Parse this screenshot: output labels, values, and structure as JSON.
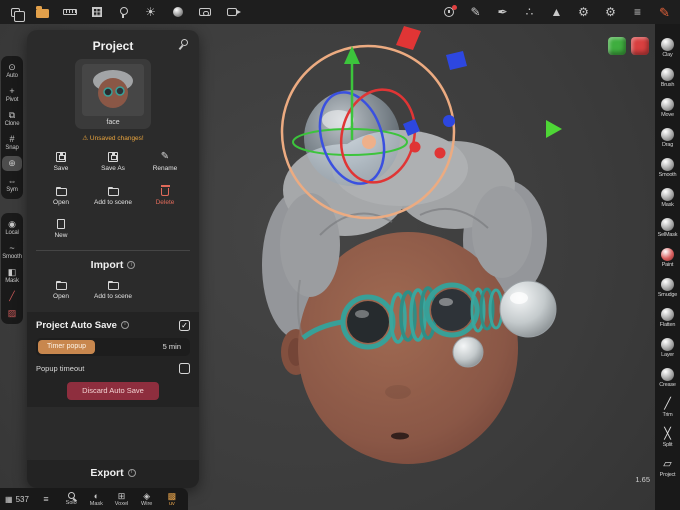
{
  "topbar": {
    "left_icons": [
      "scene-pages-icon",
      "files-folder-icon",
      "measure-icon",
      "topology-grid-icon",
      "lighting-icon",
      "environment-sun-icon",
      "material-sphere-icon",
      "camera-icon",
      "render-video-icon"
    ],
    "right_icons": [
      "record-timer-icon",
      "pencil-icon",
      "pen-icon",
      "airbrush-icon",
      "smudge-icon",
      "settings-gear-icon",
      "interface-gear-icon",
      "menu-icon",
      "stylus-pressure-icon"
    ]
  },
  "left_toolbar": {
    "group1": [
      {
        "label": "Auto",
        "icon": "auto-icon"
      },
      {
        "label": "Pivot",
        "icon": "pivot-icon"
      },
      {
        "label": "Clone",
        "icon": "clone-icon"
      },
      {
        "label": "Snap",
        "icon": "snap-icon"
      },
      {
        "label": "",
        "icon": "gizmo-icon",
        "selected": true
      },
      {
        "label": "Sym",
        "icon": "symmetry-icon"
      }
    ],
    "group2": [
      {
        "label": "Local",
        "icon": "local-icon"
      },
      {
        "label": "Smooth",
        "icon": "smooth-icon"
      },
      {
        "label": "Mask",
        "icon": "mask-icon"
      },
      {
        "label": "",
        "icon": "falloff-icon"
      },
      {
        "label": "",
        "icon": "stroke-falloff-icon"
      }
    ]
  },
  "project_panel": {
    "title": "Project",
    "thumbnail": {
      "label": "face"
    },
    "warning": "Unsaved changes!",
    "actions": {
      "save": "Save",
      "save_as": "Save As",
      "rename": "Rename",
      "open": "Open",
      "add_to_scene": "Add to scene",
      "delete": "Delete",
      "new": "New"
    },
    "import_section": {
      "title": "Import",
      "open": "Open",
      "add_to_scene": "Add to scene"
    },
    "autosave_section": {
      "title": "Project Auto Save",
      "enabled": true,
      "timer_popup_label": "Timer popup",
      "interval": "5 min",
      "popup_timeout_label": "Popup timeout",
      "popup_timeout_enabled": false,
      "discard_label": "Discard Auto Save"
    },
    "export_section": {
      "title": "Export"
    }
  },
  "right_toolbar": {
    "tools": [
      "Clay",
      "Brush",
      "Move",
      "Drag",
      "Smooth",
      "Mask",
      "SelMask",
      "Paint",
      "Smudge",
      "Flatten",
      "Layer",
      "Crease",
      "Trim",
      "Split",
      "Project"
    ]
  },
  "bottom_bar": {
    "stat_value": "537",
    "items": [
      "Solo",
      "Mask",
      "Voxel",
      "Wire",
      "uv"
    ],
    "active_item": "uv"
  },
  "viewport": {
    "zoom_indicator": "1.65",
    "overlay_buttons": [
      "green-cube-button",
      "red-cube-button"
    ]
  },
  "colors": {
    "accent_orange": "#e2a04a",
    "warning_orange": "#e8a33d",
    "delete_red": "#e06a5a",
    "discard_bg": "#8e2e3e",
    "timer_button": "#c8874e",
    "gizmo_orange": "#ecab81",
    "gizmo_green": "#3cc43c",
    "gizmo_blue": "#3a50e0",
    "gizmo_red": "#e03535",
    "goggles_teal": "#38a098"
  }
}
